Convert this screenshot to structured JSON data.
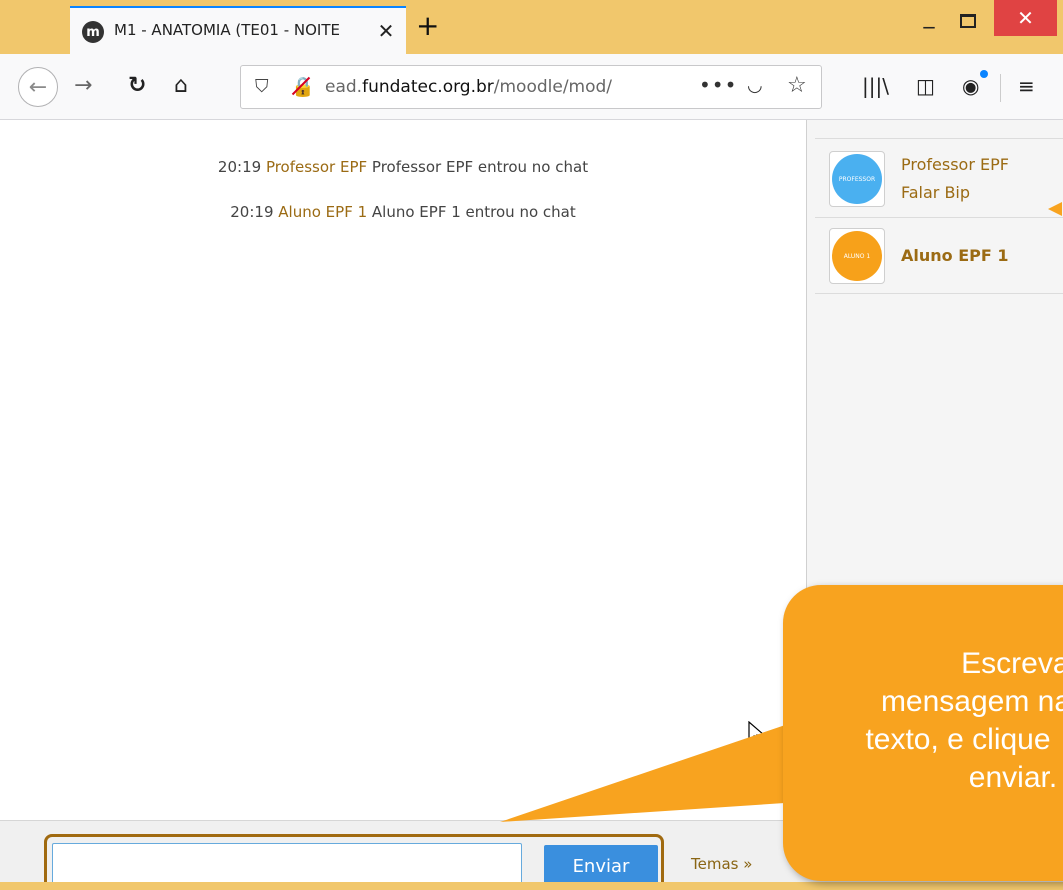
{
  "browser": {
    "tab_title": "M1 - ANATOMIA (TE01 - NOITE",
    "tab_icon_letter": "m",
    "url_prefix": "ead.",
    "url_domain": "fundatec.org.br",
    "url_path": "/moodle/mod/",
    "colors": {
      "titlebar": "#f1c76c",
      "close_button": "#e04343"
    }
  },
  "chat": {
    "messages": [
      {
        "time": "20:19",
        "user": "Professor EPF",
        "text": "Professor EPF entrou no chat"
      },
      {
        "time": "20:19",
        "user": "Aluno EPF 1",
        "text": "Aluno EPF 1 entrou no chat"
      }
    ],
    "users": [
      {
        "name": "Professor EPF",
        "action": "Falar Bip",
        "avatar_label": "PROFESSOR",
        "avatar_color": "#4ab0f0"
      },
      {
        "name": "Aluno EPF 1",
        "avatar_label": "ALUNO 1",
        "avatar_color": "#f7a11a"
      }
    ]
  },
  "composer": {
    "input_value": "",
    "send_label": "Enviar",
    "themes_label": "Temas »"
  },
  "callout": {
    "line1": "Escreva s",
    "line2": "mensagem na",
    "line3": "texto, e clique",
    "line4": "enviar.",
    "color": "#f8a31f"
  }
}
